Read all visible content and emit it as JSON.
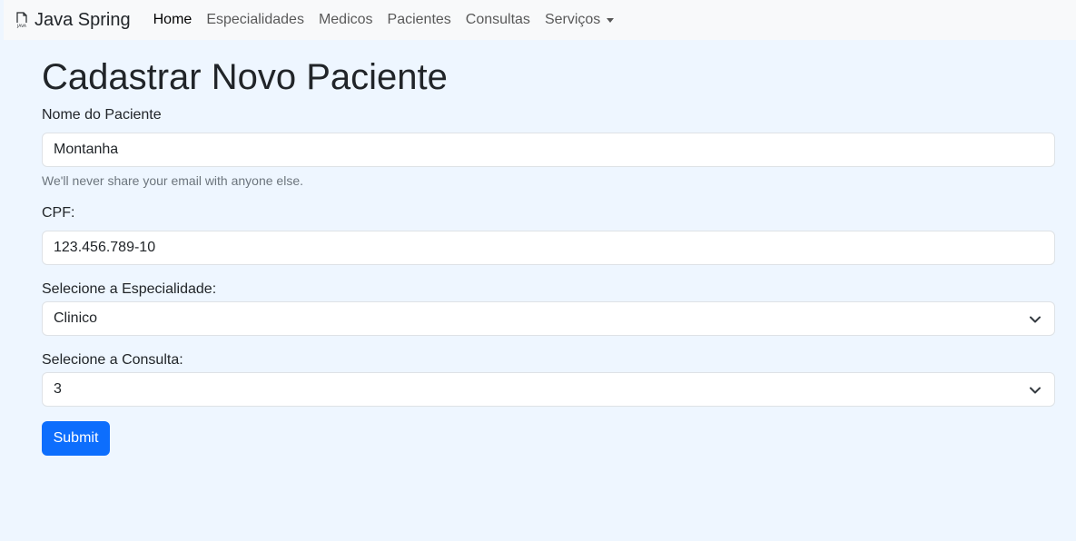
{
  "navbar": {
    "brand": "Java Spring",
    "brand_icon": "java-file-icon",
    "links": [
      {
        "label": "Home",
        "active": true
      },
      {
        "label": "Especialidades",
        "active": false
      },
      {
        "label": "Medicos",
        "active": false
      },
      {
        "label": "Pacientes",
        "active": false
      },
      {
        "label": "Consultas",
        "active": false
      }
    ],
    "dropdown": {
      "label": "Serviços"
    }
  },
  "form": {
    "title": "Cadastrar Novo Paciente",
    "nome": {
      "label": "Nome do Paciente",
      "value": "Montanha",
      "help": "We'll never share your email with anyone else."
    },
    "cpf": {
      "label": "CPF:",
      "value": "123.456.789-10"
    },
    "especialidade": {
      "label": "Selecione a Especialidade:",
      "selected": "Clinico"
    },
    "consulta": {
      "label": "Selecione a Consulta:",
      "selected": "3"
    },
    "submit_label": "Submit"
  },
  "colors": {
    "primary": "#0d6efd",
    "background": "#eef6ff",
    "navbar_bg": "#f8f9fa"
  }
}
